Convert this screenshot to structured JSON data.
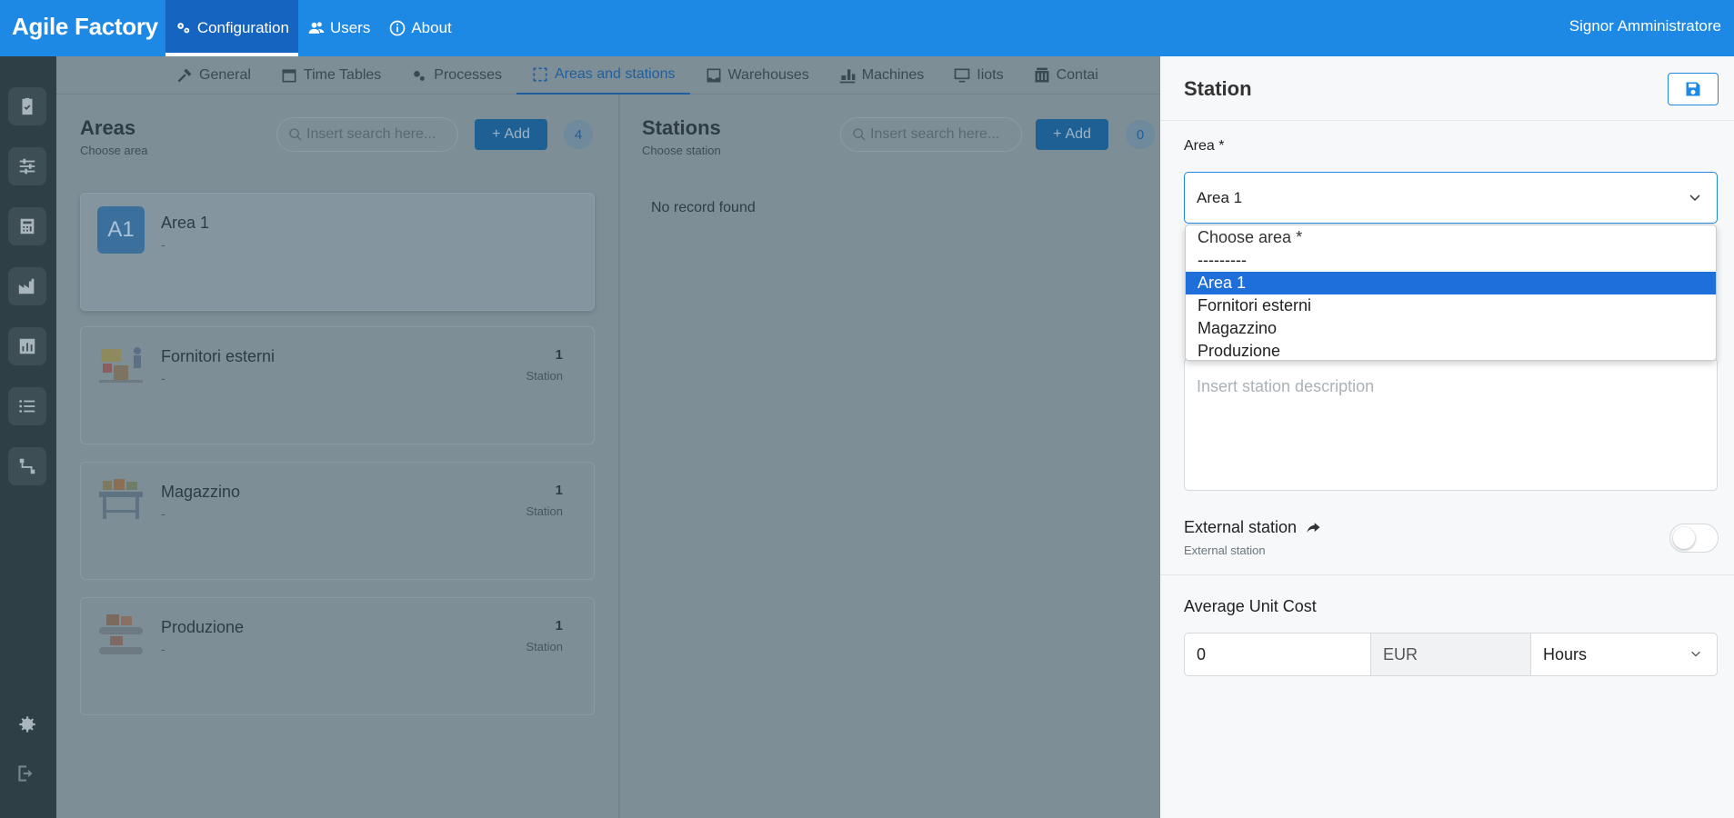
{
  "app": {
    "title": "Agile Factory",
    "user": "Signor Amministratore"
  },
  "topnav": [
    {
      "label": "Configuration",
      "icon": "gears-icon",
      "active": true
    },
    {
      "label": "Users",
      "icon": "users-icon"
    },
    {
      "label": "About",
      "icon": "info-icon"
    }
  ],
  "subtabs": [
    "General",
    "Time Tables",
    "Processes",
    "Areas and stations",
    "Warehouses",
    "Machines",
    "Iiots",
    "Contai"
  ],
  "areas": {
    "title": "Areas",
    "subtitle": "Choose area",
    "search_placeholder": "Insert search here...",
    "add_label": "Add",
    "count": "4",
    "items": [
      {
        "initials": "A1",
        "name": "Area 1",
        "desc": "-"
      },
      {
        "name": "Fornitori esterni",
        "desc": "-",
        "count": "1",
        "label": "Station"
      },
      {
        "name": "Magazzino",
        "desc": "-",
        "count": "1",
        "label": "Station"
      },
      {
        "name": "Produzione",
        "desc": "-",
        "count": "1",
        "label": "Station"
      }
    ]
  },
  "stations": {
    "title": "Stations",
    "subtitle": "Choose station",
    "search_placeholder": "Insert search here...",
    "add_label": "Add",
    "count": "0",
    "empty": "No record found"
  },
  "drawer": {
    "title": "Station",
    "area_label": "Area *",
    "area_value": "Area 1",
    "area_options": [
      "Choose area *",
      "---------",
      "Area 1",
      "Fornitori esterni",
      "Magazzino",
      "Produzione"
    ],
    "description_placeholder": "Insert station description",
    "external_title": "External station",
    "external_sub": "External station",
    "auc_title": "Average Unit Cost",
    "cost_value": "0",
    "currency": "EUR",
    "unit": "Hours"
  },
  "colors": {
    "brand": "#1e88e5",
    "selected_option": "#1e6fd9"
  }
}
